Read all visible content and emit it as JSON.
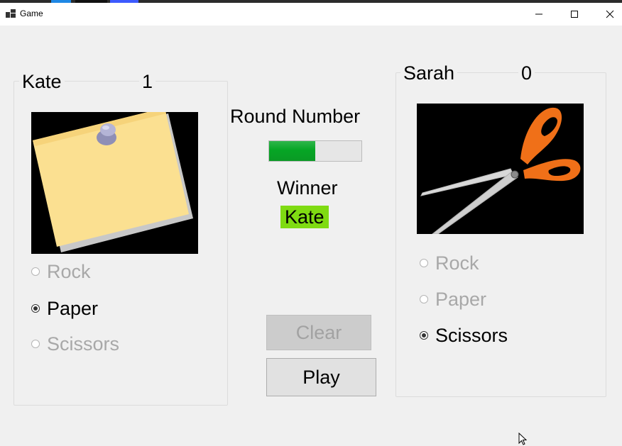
{
  "window": {
    "title": "Game",
    "controls": [
      "minimize",
      "maximize",
      "close"
    ]
  },
  "player1": {
    "name": "Kate",
    "score": "1",
    "picture_icon": "sticky-note-with-pushpin",
    "options": [
      {
        "label": "Rock",
        "checked": false,
        "enabled": false
      },
      {
        "label": "Paper",
        "checked": true,
        "enabled": true
      },
      {
        "label": "Scissors",
        "checked": false,
        "enabled": false
      }
    ]
  },
  "player2": {
    "name": "Sarah",
    "score": "0",
    "picture_icon": "scissors",
    "options": [
      {
        "label": "Rock",
        "checked": false,
        "enabled": false
      },
      {
        "label": "Paper",
        "checked": false,
        "enabled": false
      },
      {
        "label": "Scissors",
        "checked": true,
        "enabled": true
      }
    ]
  },
  "round": {
    "label": "Round Number",
    "progress_fraction": 0.5
  },
  "winner": {
    "label": "Winner",
    "value": "Kate",
    "badge_color": "#7fdb12"
  },
  "buttons": {
    "clear_label": "Clear",
    "clear_enabled": false,
    "play_label": "Play",
    "play_enabled": true
  },
  "colors": {
    "progress_green": "#06a625",
    "background": "#f0f0f0"
  }
}
